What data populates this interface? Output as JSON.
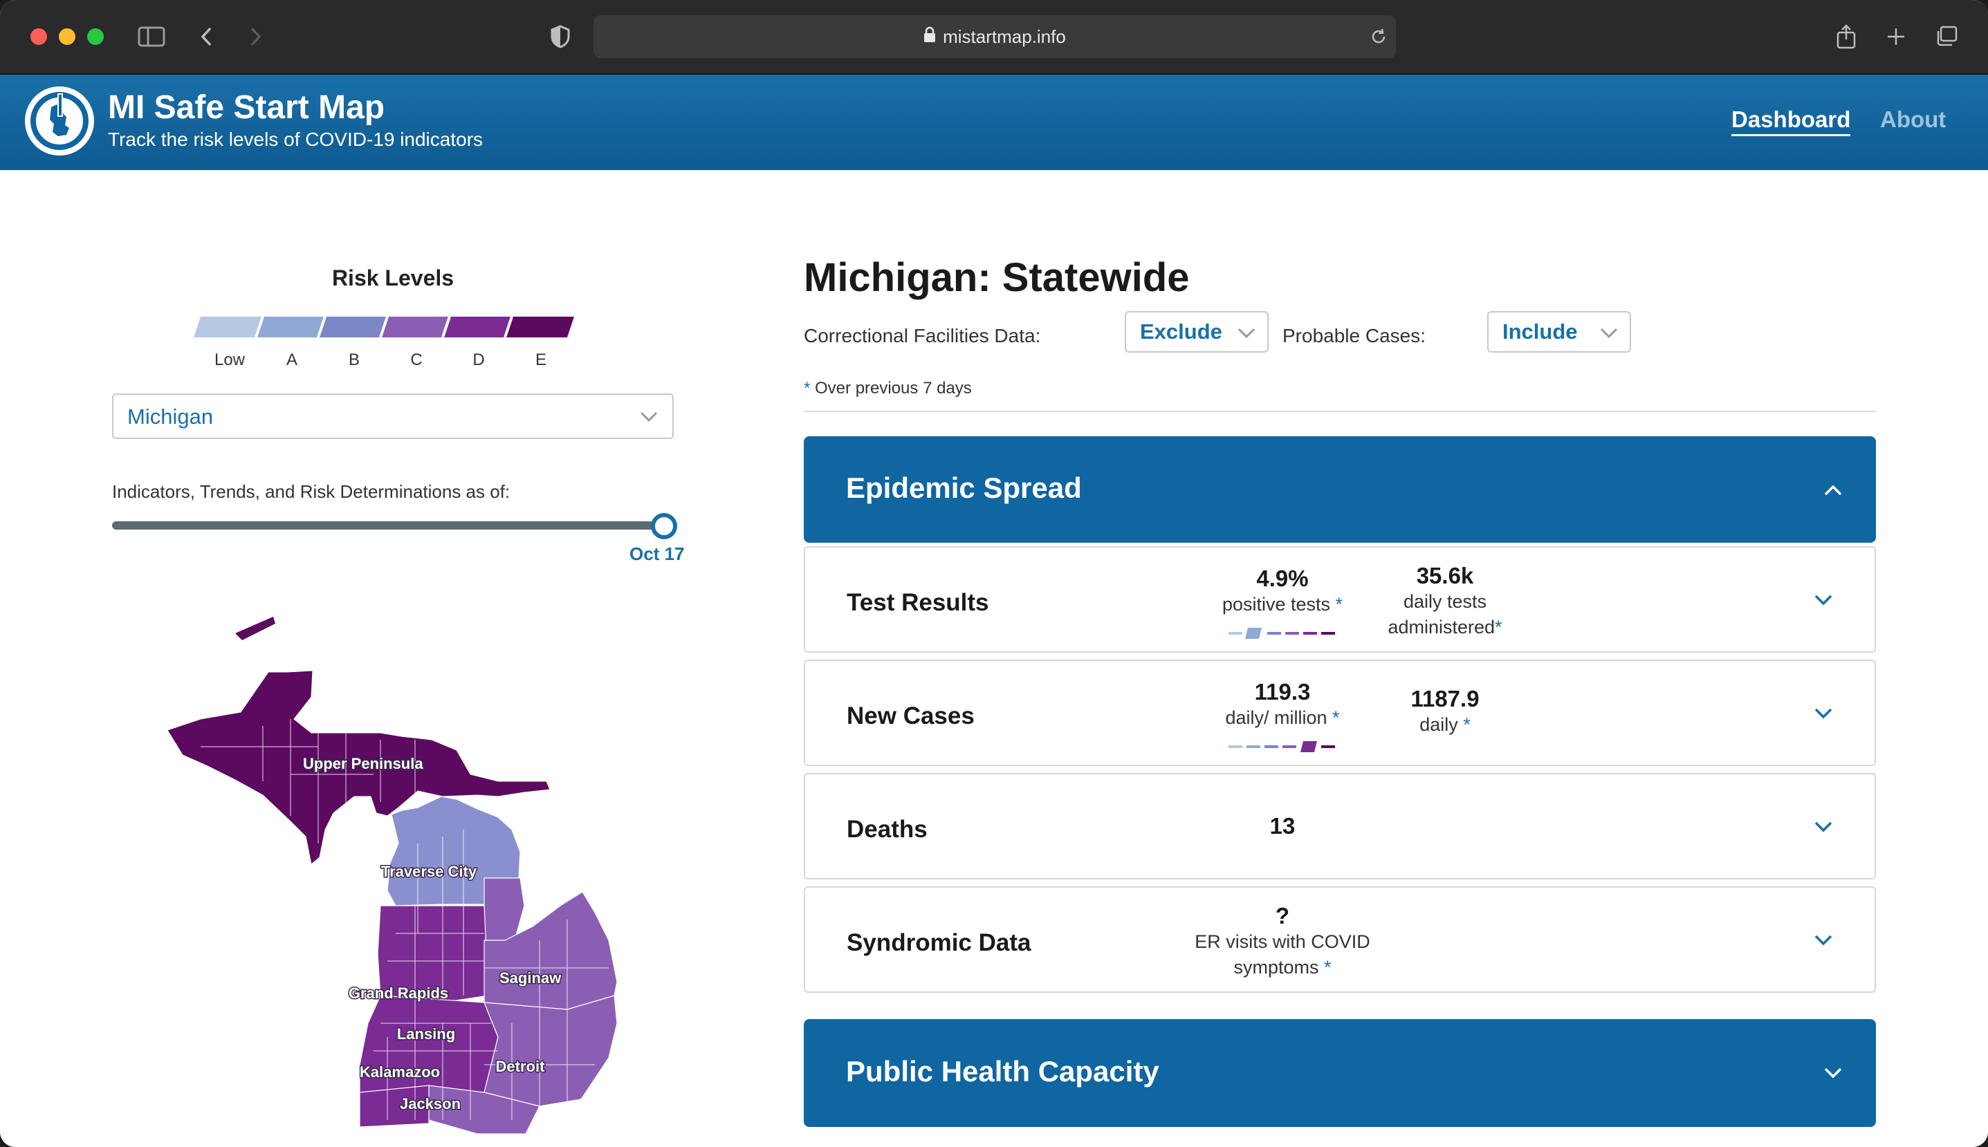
{
  "browser": {
    "url": "mistartmap.info"
  },
  "header": {
    "title": "MI Safe Start Map",
    "subtitle": "Track the risk levels of COVID-19 indicators",
    "nav": [
      {
        "label": "Dashboard",
        "active": true
      },
      {
        "label": "About",
        "active": false
      }
    ]
  },
  "sidebar": {
    "risk_title": "Risk Levels",
    "risk_levels": [
      {
        "label": "Low",
        "color": "#b7c9e2"
      },
      {
        "label": "A",
        "color": "#8fa9d4"
      },
      {
        "label": "B",
        "color": "#7a86c6"
      },
      {
        "label": "C",
        "color": "#8a5fb3"
      },
      {
        "label": "D",
        "color": "#7a2b94"
      },
      {
        "label": "E",
        "color": "#5b0a60"
      }
    ],
    "region_select": "Michigan",
    "asof_label": "Indicators, Trends, and Risk Determinations as of:",
    "slider_date": "Oct 17",
    "map_labels": [
      "Upper Peninsula",
      "Traverse City",
      "Grand Rapids",
      "Saginaw",
      "Lansing",
      "Kalamazoo",
      "Detroit",
      "Jackson"
    ]
  },
  "main": {
    "title": "Michigan: Statewide",
    "filters": {
      "correctional_label": "Correctional Facilities Data:",
      "correctional_value": "Exclude",
      "probable_label": "Probable Cases:",
      "probable_value": "Include"
    },
    "note_star": "*",
    "note_text": "Over previous 7 days",
    "sections": {
      "epidemic": "Epidemic Spread",
      "capacity": "Public Health Capacity"
    },
    "rows": {
      "test_results": {
        "title": "Test Results",
        "m1_value": "4.9%",
        "m1_label": "positive tests",
        "m1_level": "A",
        "m2_value": "35.6k",
        "m2_label_1": "daily tests",
        "m2_label_2": "administered"
      },
      "new_cases": {
        "title": "New Cases",
        "m1_value": "119.3",
        "m1_label": "daily/ million",
        "m1_level": "D",
        "m2_value": "1187.9",
        "m2_label": "daily"
      },
      "deaths": {
        "title": "Deaths",
        "m1_value": "13"
      },
      "syndromic": {
        "title": "Syndromic Data",
        "m1_value": "?",
        "m1_label_1": "ER visits with COVID",
        "m1_label_2": "symptoms"
      }
    },
    "star": "*"
  }
}
